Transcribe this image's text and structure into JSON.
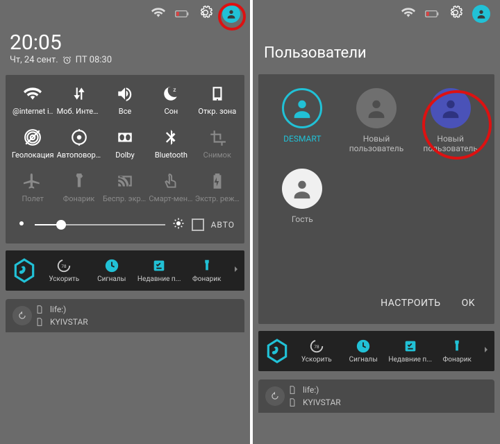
{
  "left": {
    "time": "20:05",
    "date": "Чт, 24 сент.",
    "alarm": "ПТ 08:30",
    "qs": [
      {
        "label": "@internet i..",
        "icon": "wifi",
        "dim": false
      },
      {
        "label": "Моб. Интернет",
        "icon": "data",
        "dim": false
      },
      {
        "label": "Все",
        "icon": "volume",
        "dim": false
      },
      {
        "label": "Сон",
        "icon": "moon",
        "dim": false
      },
      {
        "label": "Откр. зона",
        "icon": "hotspot",
        "dim": false
      },
      {
        "label": "Геолокация",
        "icon": "gps",
        "dim": false
      },
      {
        "label": "Автоповорот",
        "icon": "rotate",
        "dim": false
      },
      {
        "label": "Dolby",
        "icon": "dolby",
        "dim": false
      },
      {
        "label": "Bluetooth",
        "icon": "bt",
        "dim": false
      },
      {
        "label": "Снимок",
        "icon": "crop",
        "dim": true
      },
      {
        "label": "Полет",
        "icon": "plane",
        "dim": true
      },
      {
        "label": "Фонарик",
        "icon": "torch",
        "dim": true
      },
      {
        "label": "Беспр. экран",
        "icon": "cast",
        "dim": true
      },
      {
        "label": "Смарт-меню",
        "icon": "touch",
        "dim": true
      },
      {
        "label": "Экстр. режим",
        "icon": "batt",
        "dim": true
      }
    ],
    "auto": "АВТО"
  },
  "strip": [
    {
      "label": "Ускорить",
      "icon": "gauge"
    },
    {
      "label": "Сигналы",
      "icon": "clock"
    },
    {
      "label": "Недавние п...",
      "icon": "checklist"
    },
    {
      "label": "Фонарик",
      "icon": "torch2"
    }
  ],
  "notif": {
    "line1": "life:)",
    "line2": "KYIVSTAR"
  },
  "right": {
    "title": "Пользователи",
    "users": [
      {
        "name": "DESMART",
        "style": "main",
        "active": true
      },
      {
        "name": "Новый пользователь",
        "style": "grey",
        "active": false
      },
      {
        "name": "Новый пользователь",
        "style": "blue",
        "active": false
      },
      {
        "name": "Гость",
        "style": "white",
        "active": false
      }
    ],
    "btn1": "НАСТРОИТЬ",
    "btn2": "OK"
  }
}
